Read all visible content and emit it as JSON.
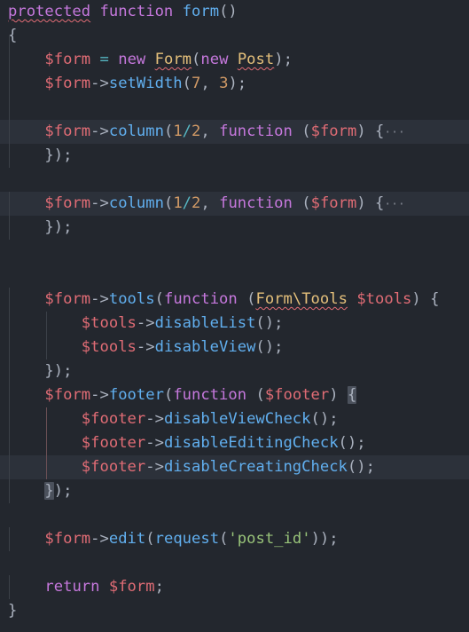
{
  "editor": {
    "language": "php",
    "theme_colors": {
      "background": "#23272e",
      "keyword": "#c678dd",
      "function": "#61afef",
      "variable": "#e06c75",
      "class": "#e5c07b",
      "number": "#d19a66",
      "string": "#98c379",
      "punctuation": "#abb2bf"
    },
    "lines": [
      {
        "tokens": [
          [
            "kw squig",
            "protected"
          ],
          [
            "p",
            " "
          ],
          [
            "kw",
            "function"
          ],
          [
            "p",
            " "
          ],
          [
            "fn",
            "form"
          ],
          [
            "p",
            "()"
          ]
        ]
      },
      {
        "tokens": [
          [
            "p",
            "{"
          ]
        ]
      },
      {
        "tokens": [
          [
            "p",
            "    "
          ],
          [
            "var",
            "$form"
          ],
          [
            "p",
            " "
          ],
          [
            "op",
            "="
          ],
          [
            "p",
            " "
          ],
          [
            "kw",
            "new"
          ],
          [
            "p",
            " "
          ],
          [
            "cls squig",
            "Form"
          ],
          [
            "p",
            "("
          ],
          [
            "kw",
            "new"
          ],
          [
            "p",
            " "
          ],
          [
            "cls squig",
            "Post"
          ],
          [
            "p",
            ");"
          ]
        ]
      },
      {
        "tokens": [
          [
            "p",
            "    "
          ],
          [
            "var",
            "$form"
          ],
          [
            "p",
            "->"
          ],
          [
            "fn",
            "setWidth"
          ],
          [
            "p",
            "("
          ],
          [
            "num",
            "7"
          ],
          [
            "p",
            ", "
          ],
          [
            "num",
            "3"
          ],
          [
            "p",
            ");"
          ]
        ]
      },
      {
        "tokens": []
      },
      {
        "highlight": true,
        "tokens": [
          [
            "p",
            "    "
          ],
          [
            "var",
            "$form"
          ],
          [
            "p",
            "->"
          ],
          [
            "fn",
            "column"
          ],
          [
            "p",
            "("
          ],
          [
            "num",
            "1"
          ],
          [
            "op",
            "/"
          ],
          [
            "num",
            "2"
          ],
          [
            "p",
            ", "
          ],
          [
            "kw",
            "function"
          ],
          [
            "p",
            " ("
          ],
          [
            "var",
            "$form"
          ],
          [
            "p",
            ") {"
          ],
          [
            "fold",
            "···"
          ]
        ]
      },
      {
        "tokens": [
          [
            "p",
            "    });"
          ]
        ]
      },
      {
        "tokens": []
      },
      {
        "highlight": true,
        "tokens": [
          [
            "p",
            "    "
          ],
          [
            "var",
            "$form"
          ],
          [
            "p",
            "->"
          ],
          [
            "fn",
            "column"
          ],
          [
            "p",
            "("
          ],
          [
            "num",
            "1"
          ],
          [
            "op",
            "/"
          ],
          [
            "num",
            "2"
          ],
          [
            "p",
            ", "
          ],
          [
            "kw",
            "function"
          ],
          [
            "p",
            " ("
          ],
          [
            "var",
            "$form"
          ],
          [
            "p",
            ") {"
          ],
          [
            "fold",
            "···"
          ]
        ]
      },
      {
        "tokens": [
          [
            "p",
            "    });"
          ]
        ]
      },
      {
        "tokens": []
      },
      {
        "tokens": []
      },
      {
        "tokens": [
          [
            "p",
            "    "
          ],
          [
            "var",
            "$form"
          ],
          [
            "p",
            "->"
          ],
          [
            "fn",
            "tools"
          ],
          [
            "p",
            "("
          ],
          [
            "kw",
            "function"
          ],
          [
            "p",
            " ("
          ],
          [
            "cls squig",
            "Form\\Tools"
          ],
          [
            "p",
            " "
          ],
          [
            "var",
            "$tools"
          ],
          [
            "p",
            ") {"
          ]
        ]
      },
      {
        "tokens": [
          [
            "p",
            "        "
          ],
          [
            "var",
            "$tools"
          ],
          [
            "p",
            "->"
          ],
          [
            "fn",
            "disableList"
          ],
          [
            "p",
            "();"
          ]
        ]
      },
      {
        "tokens": [
          [
            "p",
            "        "
          ],
          [
            "var",
            "$tools"
          ],
          [
            "p",
            "->"
          ],
          [
            "fn",
            "disableView"
          ],
          [
            "p",
            "();"
          ]
        ]
      },
      {
        "tokens": [
          [
            "p",
            "    });"
          ]
        ]
      },
      {
        "tokens": [
          [
            "p",
            "    "
          ],
          [
            "var",
            "$form"
          ],
          [
            "p",
            "->"
          ],
          [
            "fn",
            "footer"
          ],
          [
            "p",
            "("
          ],
          [
            "kw",
            "function"
          ],
          [
            "p",
            " ("
          ],
          [
            "var",
            "$footer"
          ],
          [
            "p",
            ") "
          ],
          [
            "p bm",
            "{"
          ]
        ]
      },
      {
        "tokens": [
          [
            "p",
            "        "
          ],
          [
            "var",
            "$footer"
          ],
          [
            "p",
            "->"
          ],
          [
            "fn",
            "disableViewCheck"
          ],
          [
            "p",
            "();"
          ]
        ]
      },
      {
        "tokens": [
          [
            "p",
            "        "
          ],
          [
            "var",
            "$footer"
          ],
          [
            "p",
            "->"
          ],
          [
            "fn",
            "disableEditingCheck"
          ],
          [
            "p",
            "();"
          ]
        ]
      },
      {
        "highlight": true,
        "tokens": [
          [
            "p",
            "        "
          ],
          [
            "var",
            "$footer"
          ],
          [
            "p",
            "->"
          ],
          [
            "fn",
            "disableCreatingCheck"
          ],
          [
            "p",
            "();"
          ]
        ]
      },
      {
        "tokens": [
          [
            "p",
            "    "
          ],
          [
            "p bm",
            "}"
          ],
          [
            "p",
            ");"
          ]
        ]
      },
      {
        "tokens": []
      },
      {
        "tokens": [
          [
            "p",
            "    "
          ],
          [
            "var",
            "$form"
          ],
          [
            "p",
            "->"
          ],
          [
            "fn",
            "edit"
          ],
          [
            "p",
            "("
          ],
          [
            "fn",
            "request"
          ],
          [
            "p",
            "("
          ],
          [
            "str",
            "'post_id'"
          ],
          [
            "p",
            "));"
          ]
        ]
      },
      {
        "tokens": []
      },
      {
        "tokens": [
          [
            "p",
            "    "
          ],
          [
            "kw",
            "return"
          ],
          [
            "p",
            " "
          ],
          [
            "var",
            "$form"
          ],
          [
            "p",
            ";"
          ]
        ]
      },
      {
        "tokens": [
          [
            "p",
            "}"
          ]
        ]
      }
    ]
  }
}
